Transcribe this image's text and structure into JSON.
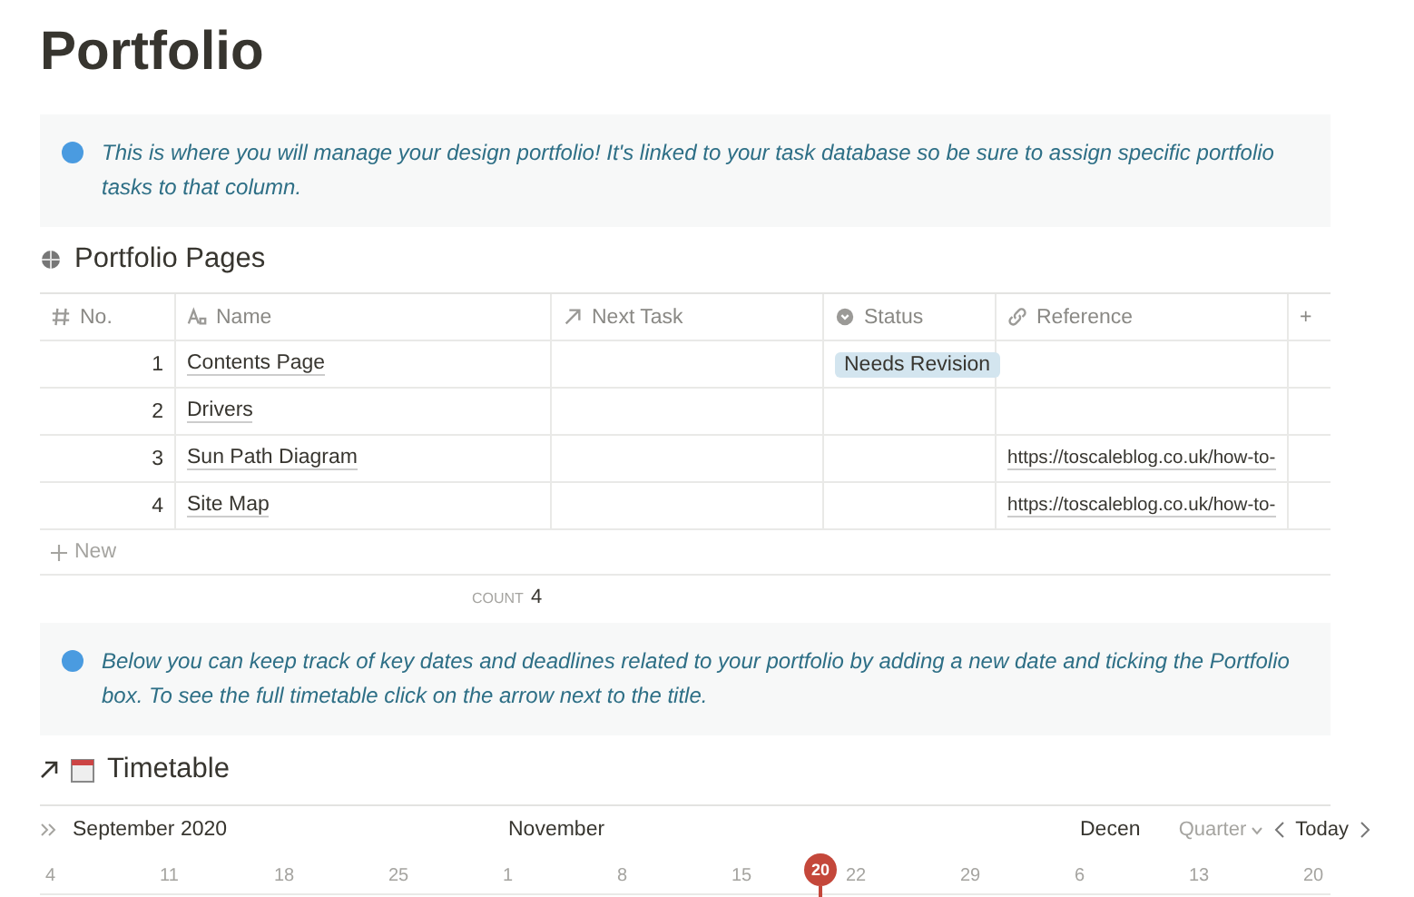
{
  "title": "Portfolio",
  "callouts": [
    {
      "text": "This is where you will manage your design portfolio! It's linked to your task database so be sure to assign specific portfolio tasks to that column."
    },
    {
      "text": "Below you can keep track of key dates and deadlines related to your portfolio by adding a new date and ticking the Portfolio box. To see the full timetable click on the arrow next to the title."
    }
  ],
  "portfolio_pages": {
    "title": "Portfolio Pages",
    "columns": [
      {
        "label": "No.",
        "kind": "number"
      },
      {
        "label": "Name",
        "kind": "title"
      },
      {
        "label": "Next Task",
        "kind": "relation"
      },
      {
        "label": "Status",
        "kind": "select"
      },
      {
        "label": "Reference",
        "kind": "url"
      }
    ],
    "add_column": "+",
    "rows": [
      {
        "no": "1",
        "name": "Contents Page",
        "status": "Needs Revision",
        "reference": ""
      },
      {
        "no": "2",
        "name": "Drivers",
        "status": "",
        "reference": ""
      },
      {
        "no": "3",
        "name": "Sun Path Diagram",
        "status": "",
        "reference": "https://toscaleblog.co.uk/how-to-"
      },
      {
        "no": "4",
        "name": "Site Map",
        "status": "",
        "reference": "https://toscaleblog.co.uk/how-to-"
      }
    ],
    "new_label": "New",
    "count_label": "COUNT",
    "count": "4"
  },
  "timetable": {
    "title": "Timetable",
    "months": [
      {
        "label": "September 2020"
      },
      {
        "label": "November"
      },
      {
        "label": "Decen"
      }
    ],
    "view": "Quarter",
    "today_button": "Today",
    "days": [
      "4",
      "11",
      "18",
      "25",
      "1",
      "8",
      "15",
      "22",
      "29",
      "6",
      "13",
      "20"
    ],
    "today": "20"
  }
}
